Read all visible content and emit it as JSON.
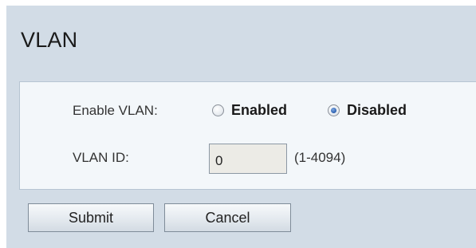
{
  "page": {
    "title": "VLAN"
  },
  "form": {
    "enable_vlan_label": "Enable VLAN:",
    "enable_options": [
      {
        "label": "Enabled",
        "checked": false
      },
      {
        "label": "Disabled",
        "checked": true
      }
    ],
    "vlan_id_label": "VLAN ID:",
    "vlan_id_value": "0",
    "vlan_id_range": "(1-4094)"
  },
  "buttons": {
    "submit_label": "Submit",
    "cancel_label": "Cancel"
  },
  "colors": {
    "frame_bg": "#d2dce6",
    "panel_bg": "#f3f7fa",
    "input_bg": "#ecebe6",
    "radio_selected": "#2a5fb0"
  }
}
